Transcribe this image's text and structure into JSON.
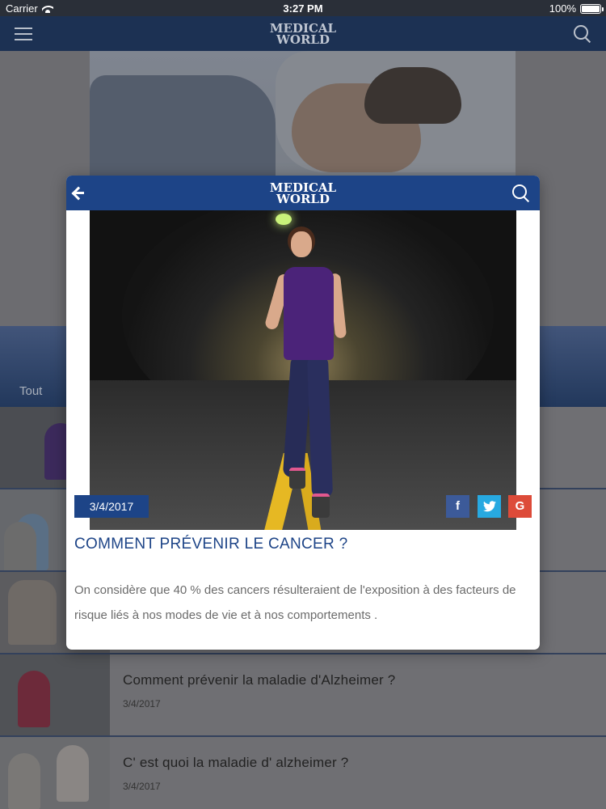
{
  "status_bar": {
    "carrier": "Carrier",
    "time": "3:27 PM",
    "battery": "100%"
  },
  "app": {
    "logo_line1": "MEDICAL",
    "logo_line2": "WORLD",
    "tabs": [
      "Tout"
    ],
    "list": [
      {
        "title": "Comment prévenir la maladie d'Alzheimer ?",
        "date": "3/4/2017"
      },
      {
        "title": "C' est quoi la maladie d' alzheimer ?",
        "date": "3/4/2017"
      }
    ]
  },
  "modal": {
    "logo_line1": "MEDICAL",
    "logo_line2": "WORLD",
    "date": "3/4/2017",
    "share": {
      "facebook": "f",
      "twitter": "t",
      "google": "G"
    },
    "title": "COMMENT PRÉVENIR LE CANCER ?",
    "paragraphs": [
      "On considère que 40 % des cancers résulteraient de l'exposition à des facteurs de risque liés à nos modes de vie et à nos comportements ."
    ]
  },
  "colors": {
    "header": "#1c3153",
    "modal_header": "#1d4487",
    "title": "#1d4487",
    "facebook": "#3c5a99",
    "twitter": "#27a9e1",
    "google": "#dd4b39"
  }
}
